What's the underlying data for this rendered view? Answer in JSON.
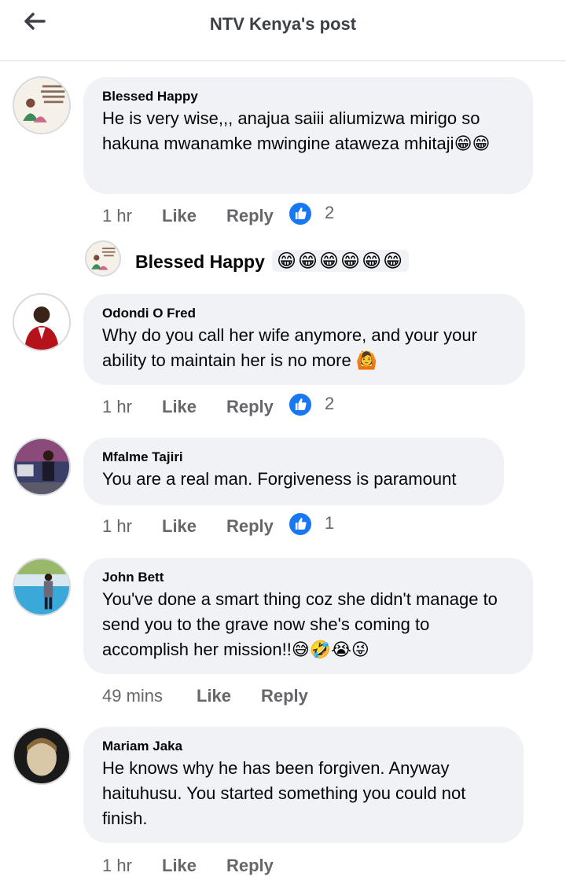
{
  "header": {
    "title": "NTV Kenya's post",
    "back_icon": "arrow-left-icon"
  },
  "comments": [
    {
      "author": "Blessed Happy",
      "text": "He is very wise,,, anajua saiii aliumizwa mirigo so hakuna mwanamke mwingine ataweza mhitaji",
      "emoji": "😁😁",
      "time": "1 hr",
      "like": "Like",
      "reply": "Reply",
      "reactions": "2",
      "reply_preview": {
        "author": "Blessed Happy",
        "emoji": "😁😁😁😁😁😁"
      }
    },
    {
      "author": "Odondi O Fred",
      "text": "Why do you call her wife anymore, and your your ability to maintain her is no more",
      "emoji": "🙆",
      "time": "1 hr",
      "like": "Like",
      "reply": "Reply",
      "reactions": "2"
    },
    {
      "author": "Mfalme Tajiri",
      "text": "You are a real man. Forgiveness is paramount",
      "time": "1 hr",
      "like": "Like",
      "reply": "Reply",
      "reactions": "1"
    },
    {
      "author": "John Bett",
      "text": "You've done a smart thing coz she didn't manage to send you to the grave now she's coming to accomplish her mission!!",
      "emoji": "😅🤣😭😜",
      "time": "49 mins",
      "like": "Like",
      "reply": "Reply"
    },
    {
      "author": "Mariam Jaka",
      "text": "He knows why he has been forgiven. Anyway haituhusu. You started something you could not finish.",
      "time": "1 hr",
      "like": "Like",
      "reply": "Reply"
    }
  ],
  "colors": {
    "like_blue": "#1877f2",
    "bubble_bg": "#f0f2f5",
    "meta_gray": "#65676b"
  }
}
